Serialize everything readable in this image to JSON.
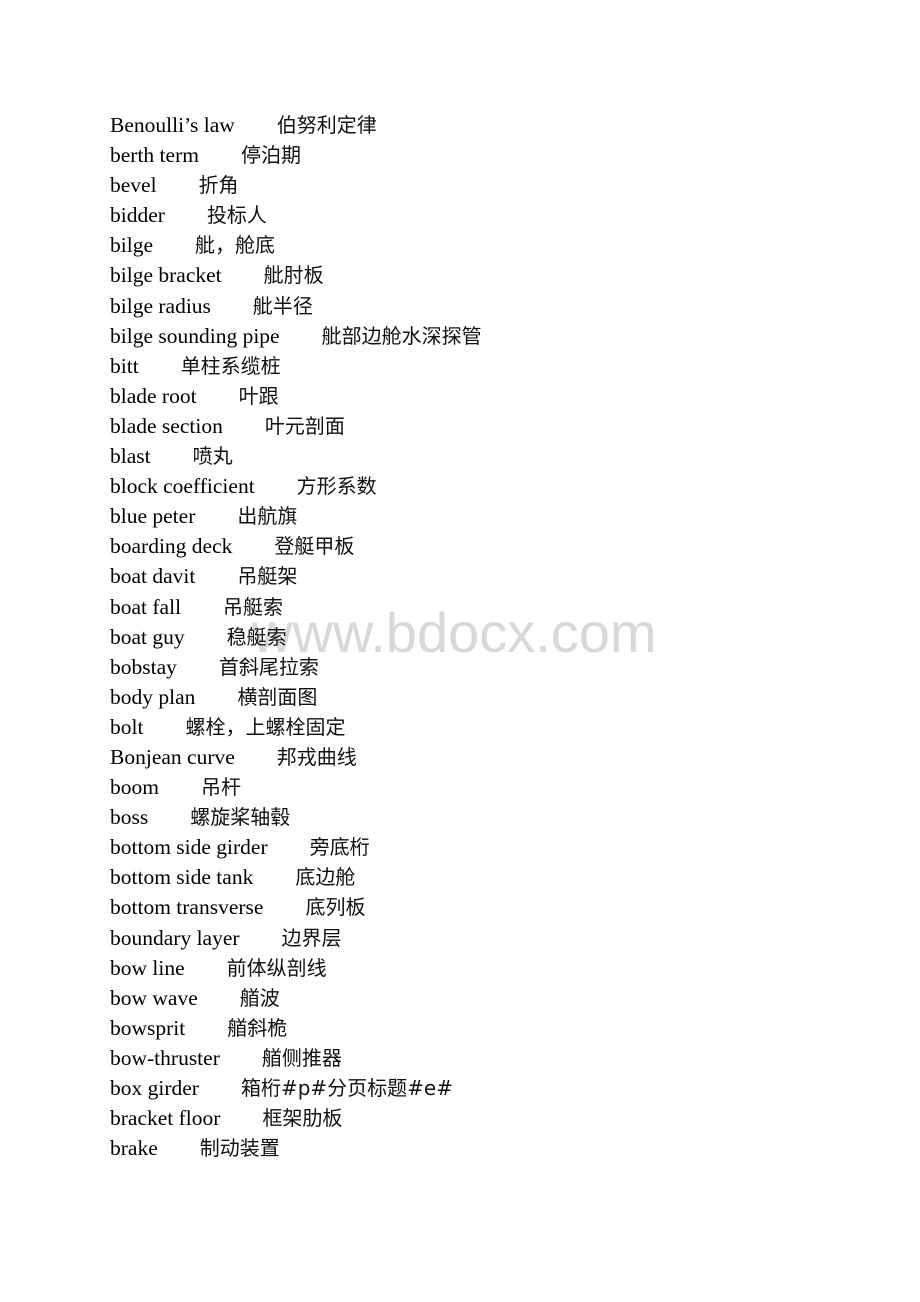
{
  "watermark": "www.bdocx.com",
  "entries": [
    {
      "term": "Benoulli’s law",
      "translation": "伯努利定律"
    },
    {
      "term": "berth term",
      "translation": "停泊期"
    },
    {
      "term": "bevel",
      "translation": "折角"
    },
    {
      "term": "bidder",
      "translation": "投标人"
    },
    {
      "term": "bilge",
      "translation": "舭，舱底"
    },
    {
      "term": "bilge bracket",
      "translation": "舭肘板"
    },
    {
      "term": "bilge radius",
      "translation": "舭半径"
    },
    {
      "term": "bilge sounding pipe",
      "translation": "舭部边舱水深探管"
    },
    {
      "term": "bitt",
      "translation": "单柱系缆桩"
    },
    {
      "term": "blade root",
      "translation": "叶跟"
    },
    {
      "term": "blade section",
      "translation": "叶元剖面"
    },
    {
      "term": "blast",
      "translation": "喷丸"
    },
    {
      "term": "block coefficient",
      "translation": "方形系数"
    },
    {
      "term": "blue peter",
      "translation": "出航旗"
    },
    {
      "term": "boarding deck",
      "translation": "登艇甲板"
    },
    {
      "term": "boat davit",
      "translation": "吊艇架"
    },
    {
      "term": "boat fall",
      "translation": "吊艇索"
    },
    {
      "term": "boat guy",
      "translation": "稳艇索"
    },
    {
      "term": "bobstay",
      "translation": "首斜尾拉索"
    },
    {
      "term": "body plan",
      "translation": "横剖面图"
    },
    {
      "term": "bolt",
      "translation": "螺栓，上螺栓固定"
    },
    {
      "term": "Bonjean curve",
      "translation": "邦戎曲线"
    },
    {
      "term": "boom",
      "translation": "吊杆"
    },
    {
      "term": "boss",
      "translation": "螺旋桨轴毂"
    },
    {
      "term": "bottom side girder",
      "translation": "旁底桁"
    },
    {
      "term": "bottom side tank",
      "translation": "底边舱"
    },
    {
      "term": "bottom transverse",
      "translation": "底列板"
    },
    {
      "term": "boundary layer",
      "translation": "边界层"
    },
    {
      "term": "bow line",
      "translation": "前体纵剖线"
    },
    {
      "term": "bow wave",
      "translation": "艏波"
    },
    {
      "term": "bowsprit",
      "translation": "艏斜桅"
    },
    {
      "term": "bow-thruster",
      "translation": "艏侧推器"
    },
    {
      "term": "box girder",
      "translation": "箱桁#p#分页标题#e#"
    },
    {
      "term": "bracket floor",
      "translation": "框架肋板"
    },
    {
      "term": "brake",
      "translation": "制动装置"
    }
  ]
}
